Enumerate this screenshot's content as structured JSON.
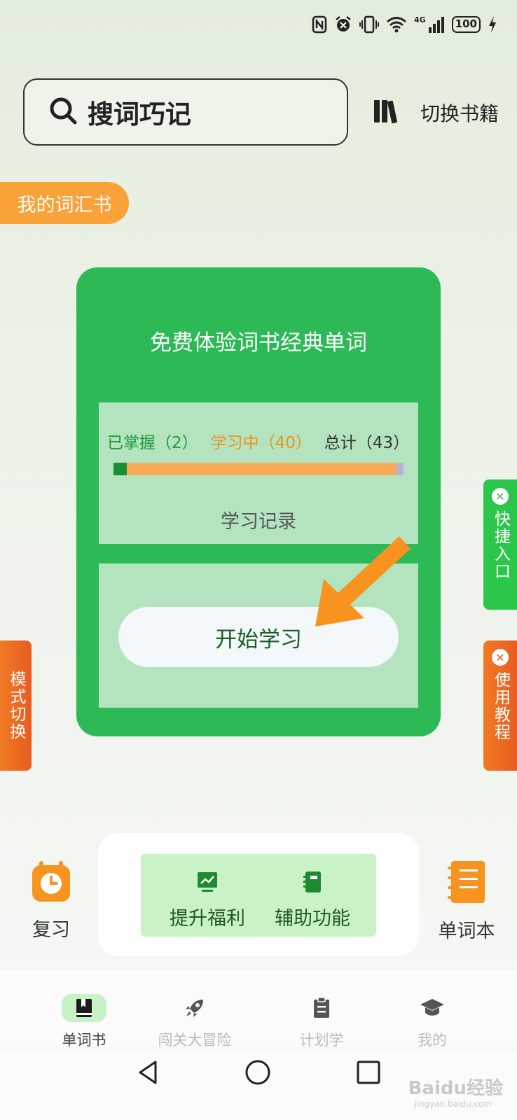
{
  "status_bar": {
    "network_label": "4G",
    "battery": "100",
    "icons": [
      "nfc-icon",
      "alarm-icon",
      "vibrate-icon",
      "wifi-icon",
      "signal-icon",
      "battery-icon",
      "charging-icon"
    ]
  },
  "search": {
    "label": "搜词巧记",
    "icon": "search-icon"
  },
  "switch_book": {
    "label": "切换书籍",
    "icon": "books-icon"
  },
  "my_vocab_tab": "我的词汇书",
  "card": {
    "title": "免费体验词书经典单词",
    "mastered_label": "已掌握（2）",
    "learning_label": "学习中（40）",
    "total_label": "总计（43）",
    "progress": {
      "mastered": 2,
      "learning": 40,
      "total": 43
    },
    "study_record": "学习记录",
    "start_button": "开始学习"
  },
  "side_tabs": {
    "mode_switch": "模式切换",
    "quick_entry": "快捷入口",
    "tutorial": "使用教程"
  },
  "tools": {
    "review": "复习",
    "boost_benefits": "提升福利",
    "aux_functions": "辅助功能",
    "wordbook": "单词本"
  },
  "bottom_nav": [
    {
      "label": "单词书",
      "icon": "book-icon",
      "active": true
    },
    {
      "label": "闯关大冒险",
      "icon": "rocket-icon",
      "active": false
    },
    {
      "label": "计划学",
      "icon": "clipboard-icon",
      "active": false
    },
    {
      "label": "我的",
      "icon": "graduation-cap-icon",
      "active": false
    }
  ],
  "watermark": {
    "text": "Baidu经验",
    "sub": "jingyan.baidu.com"
  },
  "colors": {
    "green": "#2db956",
    "orange": "#f9a23a",
    "light_green": "#b3e4bf"
  }
}
